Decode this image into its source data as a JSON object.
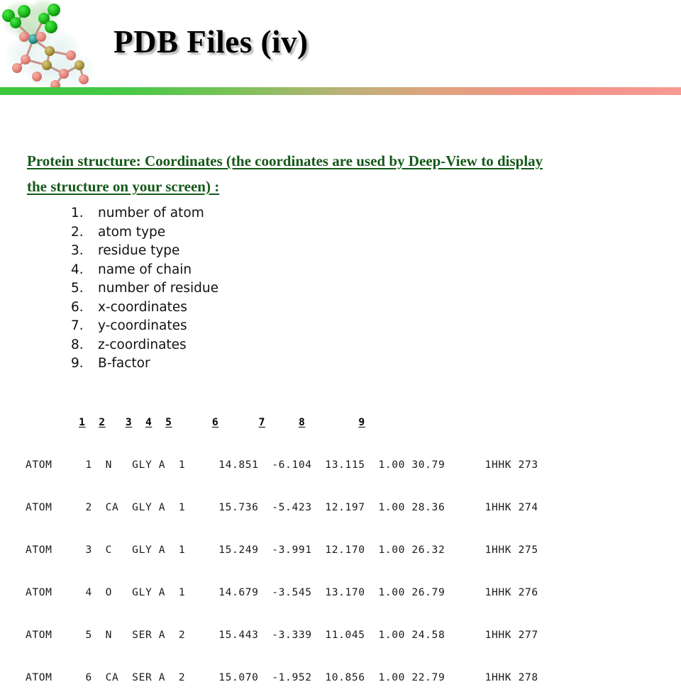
{
  "slide": {
    "title": "PDB Files (iv)",
    "graphic_name": "molecular-structure-image",
    "divider": {
      "color_left": "#3cc63c",
      "color_mid": "#b9b277",
      "color_right": "#f79a92"
    },
    "accent_green": "#15591a"
  },
  "lead": {
    "line1": "Protein structure: Coordinates (the coordinates are used by Deep-View to display",
    "line2": " the structure on your screen) :"
  },
  "field_list": [
    {
      "num": "1.",
      "label": "number of atom"
    },
    {
      "num": "2.",
      "label": "atom type"
    },
    {
      "num": "3.",
      "label": "residue type"
    },
    {
      "num": "4.",
      "label": "name of chain"
    },
    {
      "num": "5.",
      "label": "number of residue"
    },
    {
      "num": "6.",
      "label": "x-coordinates"
    },
    {
      "num": "7.",
      "label": "y-coordinates"
    },
    {
      "num": "8.",
      "label": "z-coordinates"
    },
    {
      "num": "9.",
      "label": "B-factor"
    }
  ],
  "pdb": {
    "column_markers": [
      "1",
      "2",
      "3",
      "4",
      "5",
      "6",
      "7",
      "8",
      "9"
    ],
    "header_line": "        1  2   3  4  5      6      7     8        9 ",
    "rows": [
      {
        "record": "ATOM",
        "serial": "1",
        "atom_type": "N",
        "residue": "GLY",
        "chain": "A",
        "residue_number": "1",
        "x": "14.851",
        "y": "-6.104",
        "z": "13.115",
        "occupancy": "1.00",
        "b_factor": "30.79",
        "entry": "1HHK",
        "index": "273",
        "text": "ATOM     1  N   GLY A  1     14.851  -6.104  13.115  1.00 30.79      1HHK 273"
      },
      {
        "record": "ATOM",
        "serial": "2",
        "atom_type": "CA",
        "residue": "GLY",
        "chain": "A",
        "residue_number": "1",
        "x": "15.736",
        "y": "-5.423",
        "z": "12.197",
        "occupancy": "1.00",
        "b_factor": "28.36",
        "entry": "1HHK",
        "index": "274",
        "text": "ATOM     2  CA  GLY A  1     15.736  -5.423  12.197  1.00 28.36      1HHK 274"
      },
      {
        "record": "ATOM",
        "serial": "3",
        "atom_type": "C",
        "residue": "GLY",
        "chain": "A",
        "residue_number": "1",
        "x": "15.249",
        "y": "-3.991",
        "z": "12.170",
        "occupancy": "1.00",
        "b_factor": "26.32",
        "entry": "1HHK",
        "index": "275",
        "text": "ATOM     3  C   GLY A  1     15.249  -3.991  12.170  1.00 26.32      1HHK 275"
      },
      {
        "record": "ATOM",
        "serial": "4",
        "atom_type": "O",
        "residue": "GLY",
        "chain": "A",
        "residue_number": "1",
        "x": "14.679",
        "y": "-3.545",
        "z": "13.170",
        "occupancy": "1.00",
        "b_factor": "26.79",
        "entry": "1HHK",
        "index": "276",
        "text": "ATOM     4  O   GLY A  1     14.679  -3.545  13.170  1.00 26.79      1HHK 276"
      },
      {
        "record": "ATOM",
        "serial": "5",
        "atom_type": "N",
        "residue": "SER",
        "chain": "A",
        "residue_number": "2",
        "x": "15.443",
        "y": "-3.339",
        "z": "11.045",
        "occupancy": "1.00",
        "b_factor": "24.58",
        "entry": "1HHK",
        "index": "277",
        "text": "ATOM     5  N   SER A  2     15.443  -3.339  11.045  1.00 24.58      1HHK 277"
      },
      {
        "record": "ATOM",
        "serial": "6",
        "atom_type": "CA",
        "residue": "SER",
        "chain": "A",
        "residue_number": "2",
        "x": "15.070",
        "y": "-1.952",
        "z": "10.856",
        "occupancy": "1.00",
        "b_factor": "22.79",
        "entry": "1HHK",
        "index": "278",
        "text": "ATOM     6  CA  SER A  2     15.070  -1.952  10.856  1.00 22.79      1HHK 278"
      }
    ]
  }
}
